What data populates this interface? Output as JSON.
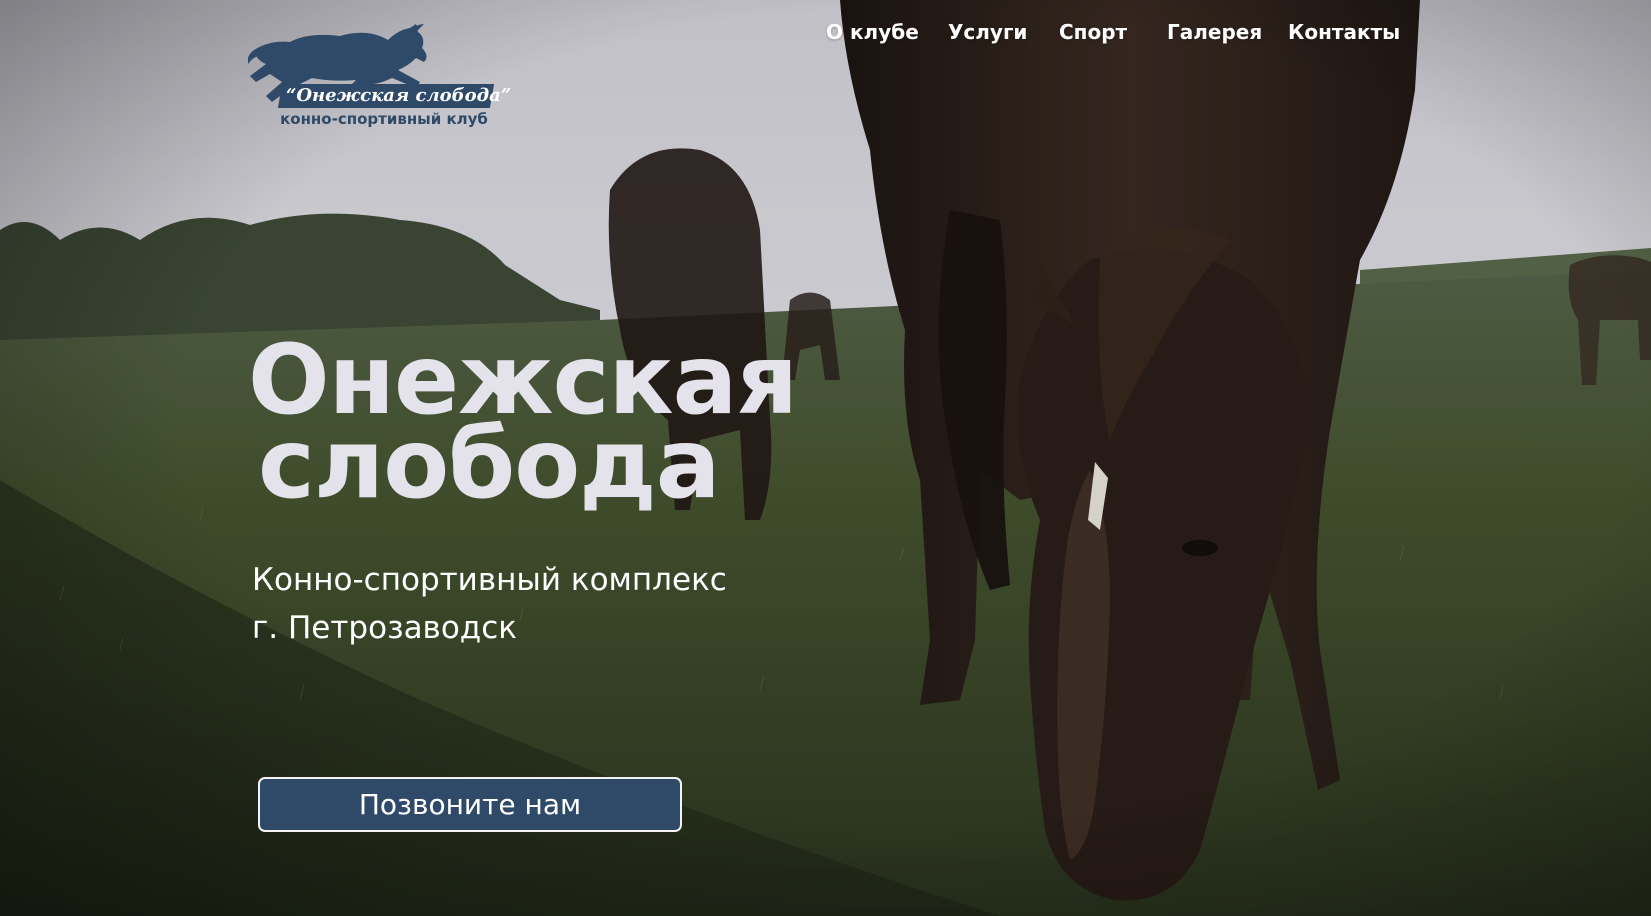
{
  "nav": {
    "items": [
      {
        "label": "О клубе"
      },
      {
        "label": "Услуги"
      },
      {
        "label": "Спорт"
      },
      {
        "label": "Галерея"
      },
      {
        "label": "Контакты"
      }
    ]
  },
  "logo": {
    "name": "“Онежская слобода”",
    "tagline": "конно-спортивный клуб"
  },
  "hero": {
    "title_line1": "Онежская",
    "title_line2": "слобода",
    "subtitle_line1": "Конно-спортивный комплекс",
    "subtitle_line2": "г. Петрозаводск",
    "cta_label": "Позвоните нам"
  },
  "colors": {
    "brand_navy": "#2f4a68",
    "title_text": "#e4e2ea",
    "sky": "#d9d8df",
    "grass": "#3c4a2b"
  },
  "icons": {
    "logo_mark": "jumping-horse-icon"
  }
}
